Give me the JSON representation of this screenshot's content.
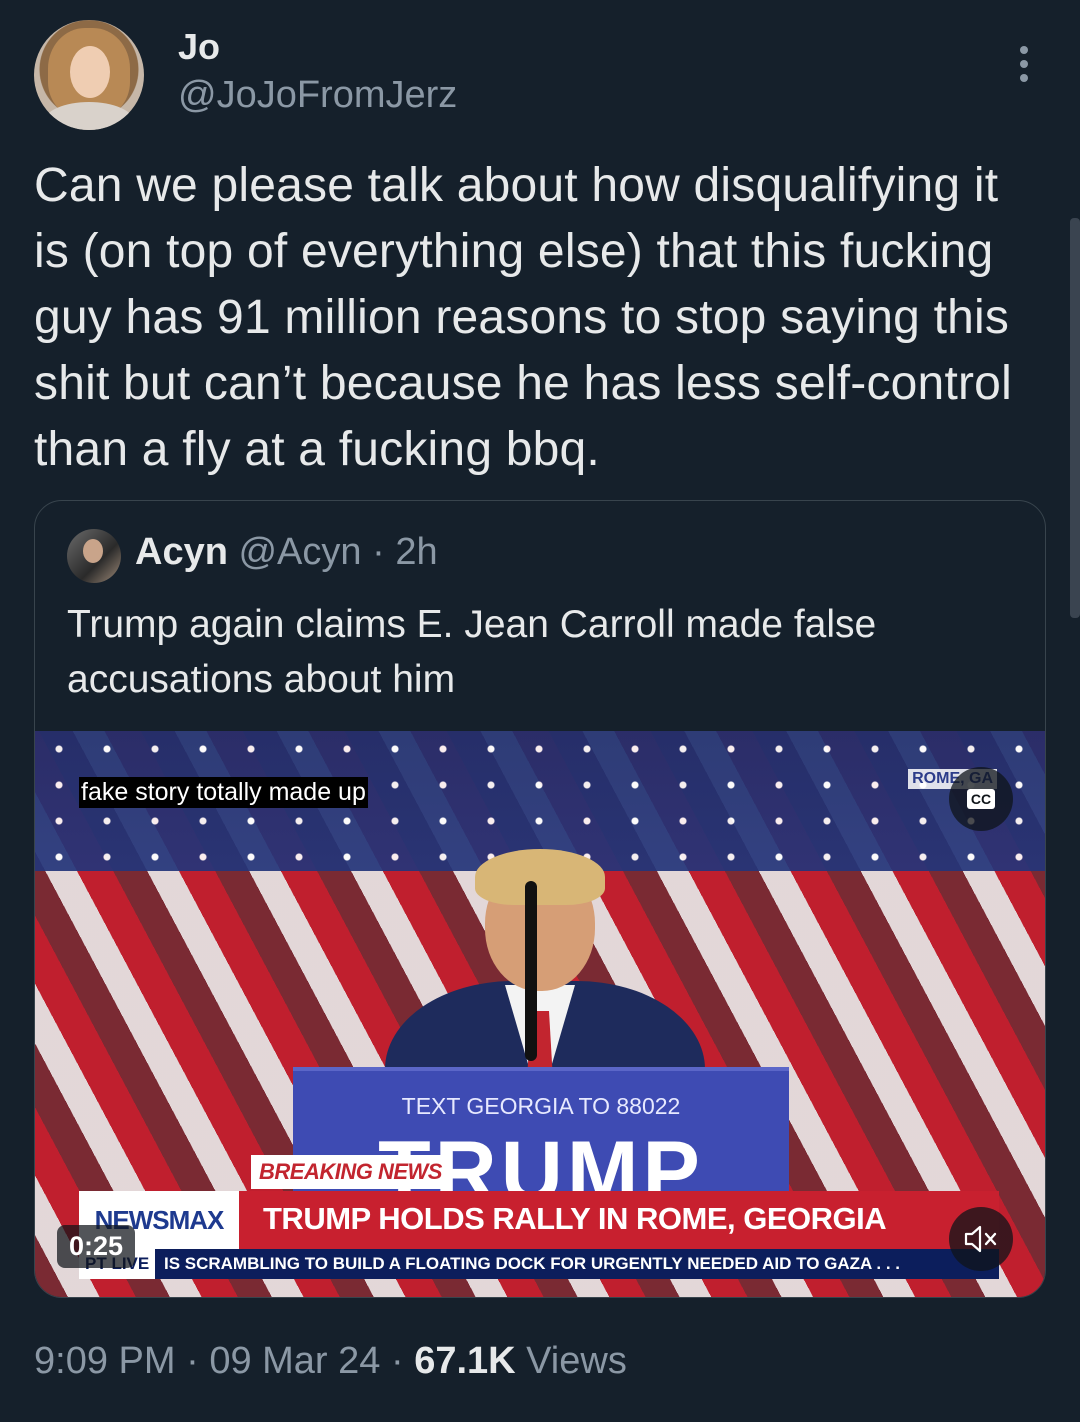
{
  "author": {
    "display_name": "Jo",
    "handle": "@JoJoFromJerz",
    "avatar_icon": "avatar-photo"
  },
  "tweet": {
    "text": "Can we please talk about how disqualifying it is (on top of everything else) that this fucking guy has 91 million reasons to stop saying this shit but can’t because he has less self-control than a fly at a fucking bbq."
  },
  "quote": {
    "display_name": "Acyn",
    "handle": "@Acyn",
    "time": " · 2h",
    "text": "Trump again claims E. Jean Carroll made false accusations about him",
    "video": {
      "caption": "fake story totally made up",
      "location": "ROME, GA",
      "cc_label": "CC",
      "podium_line": "TEXT GEORGIA TO 88022",
      "podium_big": "TRUMP",
      "breaking": "BREAKING NEWS",
      "brand": "NEWSMAX",
      "headline": "TRUMP HOLDS RALLY IN ROME, GEORGIA",
      "ticker_label": "PT   LIVE",
      "ticker": "IS SCRAMBLING TO BUILD A FLOATING DOCK FOR URGENTLY NEEDED AID TO GAZA . . .",
      "duration": "0:25"
    }
  },
  "footer": {
    "time": "9:09 PM",
    "sep1": " · ",
    "date": "09 Mar 24",
    "sep2": " · ",
    "views_count": "67.1K",
    "views_label": " Views"
  },
  "colors": {
    "background": "#15202b",
    "text": "#e7e9ea",
    "muted": "#8b98a5",
    "border": "#38444d"
  }
}
